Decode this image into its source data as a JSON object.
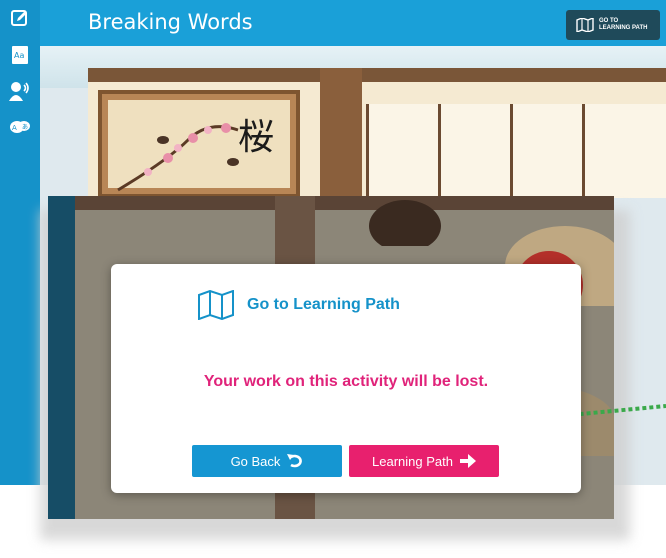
{
  "back_window": {
    "title": "Breaking Words",
    "goto_button": {
      "label": "GO TO\nLEARNING PATH",
      "icon": "map-icon"
    },
    "sidebar_icons": [
      "edit-icon",
      "dictionary-icon",
      "speaker-icon",
      "translate-icon"
    ],
    "scene_kanji": "桜"
  },
  "dialog": {
    "icon": "map-icon",
    "title": "Go to Learning Path",
    "message": "Your work on this activity will be lost.",
    "go_back_label": "Go Back",
    "learning_path_label": "Learning Path"
  },
  "colors": {
    "primary_blue": "#1592c9",
    "accent_pink": "#e0237a",
    "button_pink": "#e8206e",
    "dark_button": "#1f4a5a"
  }
}
